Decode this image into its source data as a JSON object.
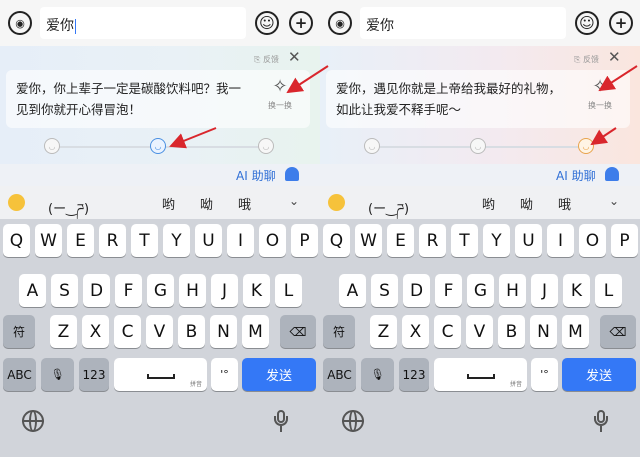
{
  "left": {
    "input": "爱你",
    "feedback": "⎘ 反馈",
    "close": "✕",
    "suggestion": "爱你，你上辈子一定是碳酸饮料吧？我一见到你就开心得冒泡！",
    "refresh_label": "换一换",
    "levels": [
      "◡",
      "◡",
      "◡"
    ],
    "ai_label": "AI 助聊",
    "candidates": [
      "(ー‿ཌ)",
      "哟",
      "呦",
      "哦"
    ],
    "row1": [
      "Q",
      "W",
      "E",
      "R",
      "T",
      "Y",
      "U",
      "I",
      "O",
      "P"
    ],
    "row2": [
      "A",
      "S",
      "D",
      "F",
      "G",
      "H",
      "J",
      "K",
      "L"
    ],
    "row3": [
      "Z",
      "X",
      "C",
      "V",
      "B",
      "N",
      "M"
    ],
    "symbol_key": "符",
    "delete_key": "⌫",
    "abc_key": "ABC",
    "num_key": "123",
    "space_hint": "拼音",
    "punct_key": "'°",
    "send_key": "发送"
  },
  "right": {
    "input": "爱你",
    "feedback": "⎘ 反馈",
    "close": "✕",
    "suggestion": "爱你，遇见你就是上帝给我最好的礼物，如此让我爱不释手呢～",
    "refresh_label": "换一换",
    "levels": [
      "◡",
      "◡",
      "◡"
    ],
    "ai_label": "AI 助聊",
    "candidates": [
      "(ー‿ཌ)",
      "哟",
      "呦",
      "哦"
    ],
    "row1": [
      "Q",
      "W",
      "E",
      "R",
      "T",
      "Y",
      "U",
      "I",
      "O",
      "P"
    ],
    "row2": [
      "A",
      "S",
      "D",
      "F",
      "G",
      "H",
      "J",
      "K",
      "L"
    ],
    "row3": [
      "Z",
      "X",
      "C",
      "V",
      "B",
      "N",
      "M"
    ],
    "symbol_key": "符",
    "delete_key": "⌫",
    "abc_key": "ABC",
    "num_key": "123",
    "space_hint": "拼音",
    "punct_key": "'°",
    "send_key": "发送"
  },
  "colors": {
    "accent": "#3478f6",
    "arrow": "#d9262c"
  }
}
